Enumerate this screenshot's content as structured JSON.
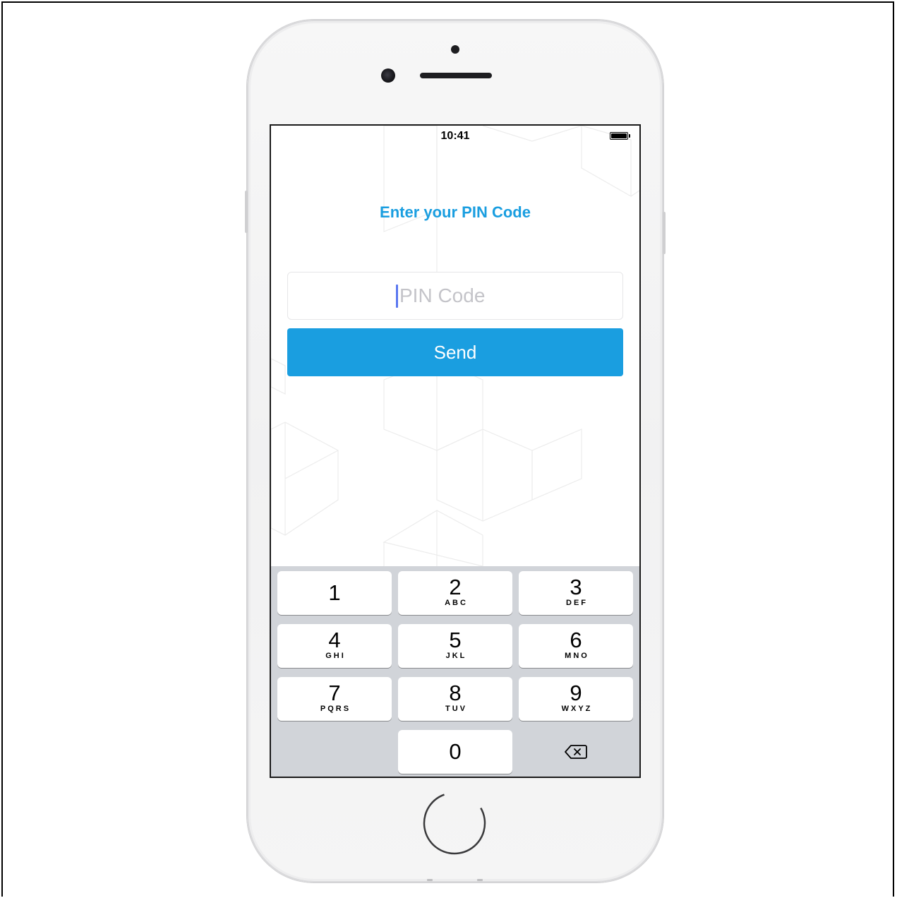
{
  "status_bar": {
    "time": "10:41"
  },
  "screen": {
    "title": "Enter your PIN Code",
    "pin_input": {
      "placeholder": "PIN Code",
      "value": ""
    },
    "send_label": "Send"
  },
  "keypad": {
    "keys": [
      {
        "digit": "1",
        "letters": ""
      },
      {
        "digit": "2",
        "letters": "ABC"
      },
      {
        "digit": "3",
        "letters": "DEF"
      },
      {
        "digit": "4",
        "letters": "GHI"
      },
      {
        "digit": "5",
        "letters": "JKL"
      },
      {
        "digit": "6",
        "letters": "MNO"
      },
      {
        "digit": "7",
        "letters": "PQRS"
      },
      {
        "digit": "8",
        "letters": "TUV"
      },
      {
        "digit": "9",
        "letters": "WXYZ"
      },
      {
        "digit": "0",
        "letters": ""
      }
    ],
    "delete_icon": "backspace-icon"
  },
  "colors": {
    "accent": "#1a9ee0",
    "keyboard_bg": "#d1d4d9"
  }
}
